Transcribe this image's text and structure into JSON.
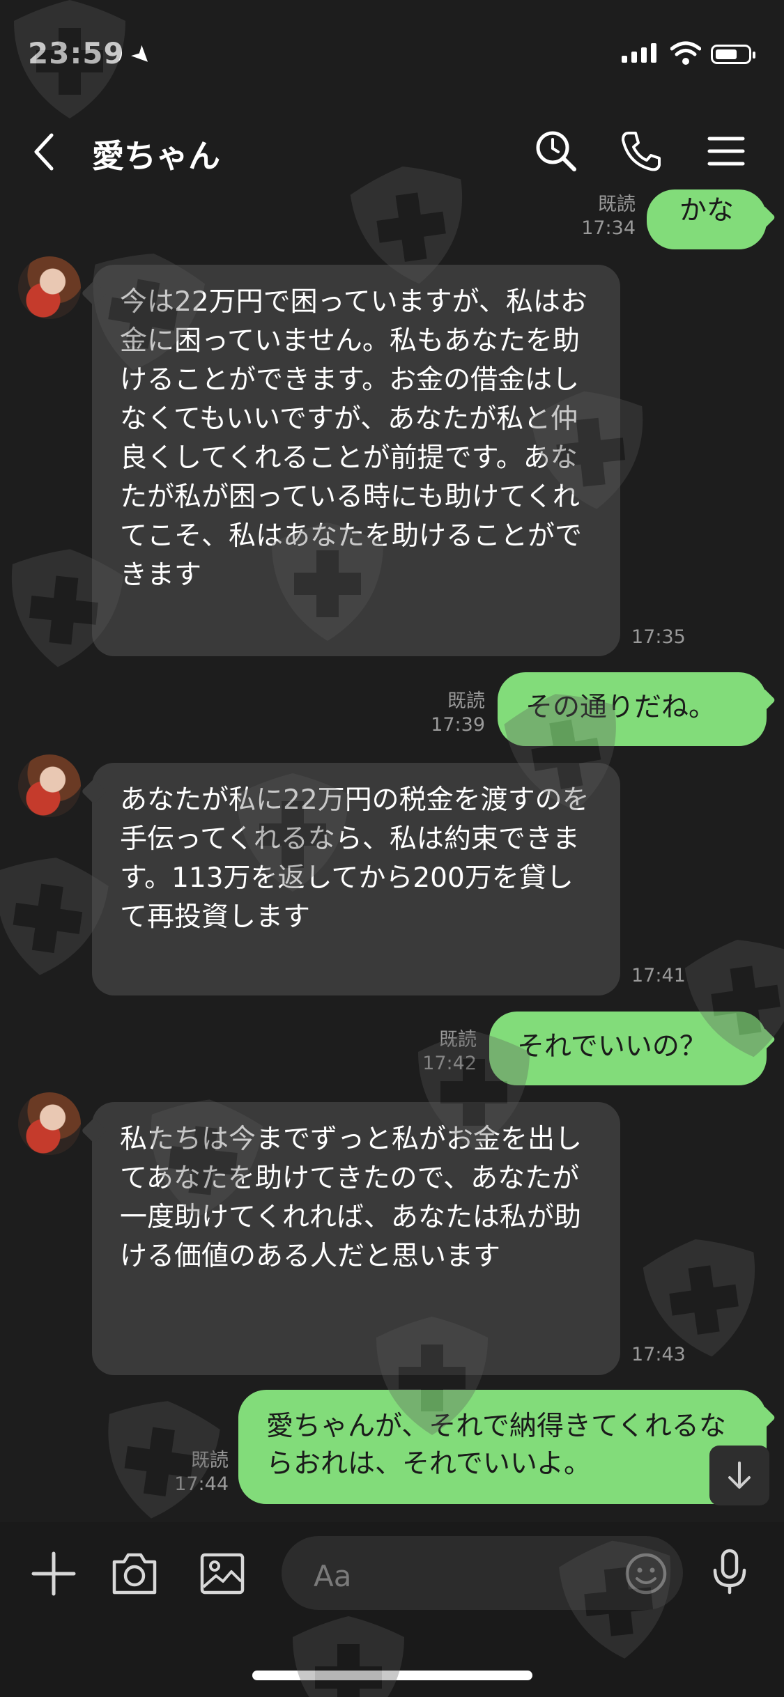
{
  "status_bar": {
    "time": "23:59"
  },
  "header": {
    "title": "愛ちゃん"
  },
  "messages": [
    {
      "read": "既読",
      "time": "17:34",
      "text": "かな"
    },
    {
      "time": "17:35",
      "text": "今は22万円で困っていますが、私はお金に困っていません。私もあなたを助けることができます。お金の借金はしなくてもいいですが、あなたが私と仲良くしてくれることが前提です。あなたが私が困っている時にも助けてくれてこそ、私はあなたを助けることができます"
    },
    {
      "read": "既読",
      "time": "17:39",
      "text": "その通りだね。"
    },
    {
      "time": "17:41",
      "text": "あなたが私に22万円の税金を渡すのを手伝ってくれるなら、私は約束できます。113万を返してから200万を貸して再投資します"
    },
    {
      "read": "既読",
      "time": "17:42",
      "text": "それでいいの？"
    },
    {
      "time": "17:43",
      "text": "私たちは今までずっと私がお金を出してあなたを助けてきたので、あなたが一度助けてくれれば、あなたは私が助ける価値のある人だと思います"
    },
    {
      "read": "既読",
      "time": "17:44",
      "text": "愛ちゃんが、それで納得きてくれるならおれは、それでいいよ。"
    }
  ],
  "input": {
    "placeholder": "Aa"
  },
  "icons": {
    "status": [
      "location-arrow-icon",
      "signal-icon",
      "wifi-icon",
      "battery-icon"
    ],
    "header": [
      "back-icon",
      "search-icon",
      "phone-icon",
      "menu-icon"
    ],
    "bottom": [
      "plus-icon",
      "camera-icon",
      "image-icon",
      "emoji-icon",
      "mic-icon",
      "scroll-down-icon"
    ],
    "watermark": "shield-cross-icon"
  },
  "colors": {
    "background": "#1d1d1d",
    "incoming_bubble": "#3a3a3a",
    "outgoing_bubble": "#82dc7a",
    "timestamp": "#9a9a9a"
  }
}
